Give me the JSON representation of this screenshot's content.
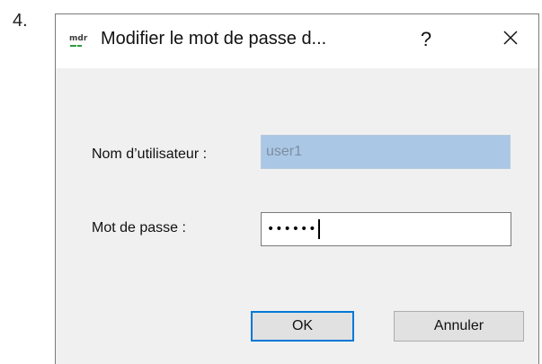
{
  "step": {
    "number": "4."
  },
  "dialog": {
    "title": "Modifier le mot de passe d...",
    "help_label": "?",
    "app_icon": "app-logo-icon",
    "close_icon": "close-icon"
  },
  "form": {
    "username_label": "Nom d’utilisateur :",
    "username_value": "user1",
    "password_label": "Mot de passe :",
    "password_value": "••••••"
  },
  "buttons": {
    "ok_label": "OK",
    "cancel_label": "Annuler"
  },
  "colors": {
    "accent": "#0078d7",
    "disabled_field_bg": "#aac7e6",
    "dialog_bg": "#f0f0f0"
  }
}
